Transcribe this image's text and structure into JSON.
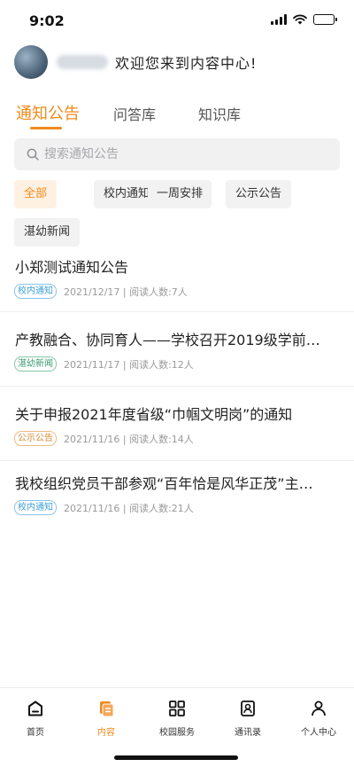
{
  "status_bar": {
    "time": "9:02"
  },
  "header": {
    "welcome": "欢迎您来到内容中心!"
  },
  "tabs": [
    {
      "label": "通知公告",
      "active": true
    },
    {
      "label": "问答库",
      "active": false
    },
    {
      "label": "知识库",
      "active": false
    }
  ],
  "search": {
    "placeholder": "搜索通知公告",
    "value": ""
  },
  "filters": [
    "全部",
    "校内通知",
    "一周安排",
    "公示公告",
    "湛幼新闻"
  ],
  "selected_filter": "全部",
  "notices": [
    {
      "title": "小郑测试通知公告",
      "tag": "校内通知",
      "tag_color": "#3c9ed8",
      "meta": "2021/12/17 | 阅读人数:7人"
    },
    {
      "title": "产教融合、协同育人——学校召开2019级学前…",
      "tag": "湛幼新闻",
      "tag_color": "#3a9a6f",
      "meta": "2021/11/17 | 阅读人数:12人"
    },
    {
      "title": "关于申报2021年度省级“巾帼文明岗”的通知",
      "tag": "公示公告",
      "tag_color": "#d68a34",
      "meta": "2021/11/16 | 阅读人数:14人"
    },
    {
      "title": "我校组织党员干部参观“百年恰是风华正茂”主…",
      "tag": "校内通知",
      "tag_color": "#3c9ed8",
      "meta": "2021/11/16 | 阅读人数:21人"
    }
  ],
  "bottom_nav": [
    {
      "label": "首页",
      "icon": "home-icon",
      "active": false
    },
    {
      "label": "内容",
      "icon": "content-icon",
      "active": true
    },
    {
      "label": "校园服务",
      "icon": "grid-icon",
      "active": false
    },
    {
      "label": "通讯录",
      "icon": "contacts-icon",
      "active": false
    },
    {
      "label": "个人中心",
      "icon": "profile-icon",
      "active": false
    }
  ],
  "colors": {
    "accent": "#f08a1d",
    "chip_active_bg": "#fff1e2"
  }
}
